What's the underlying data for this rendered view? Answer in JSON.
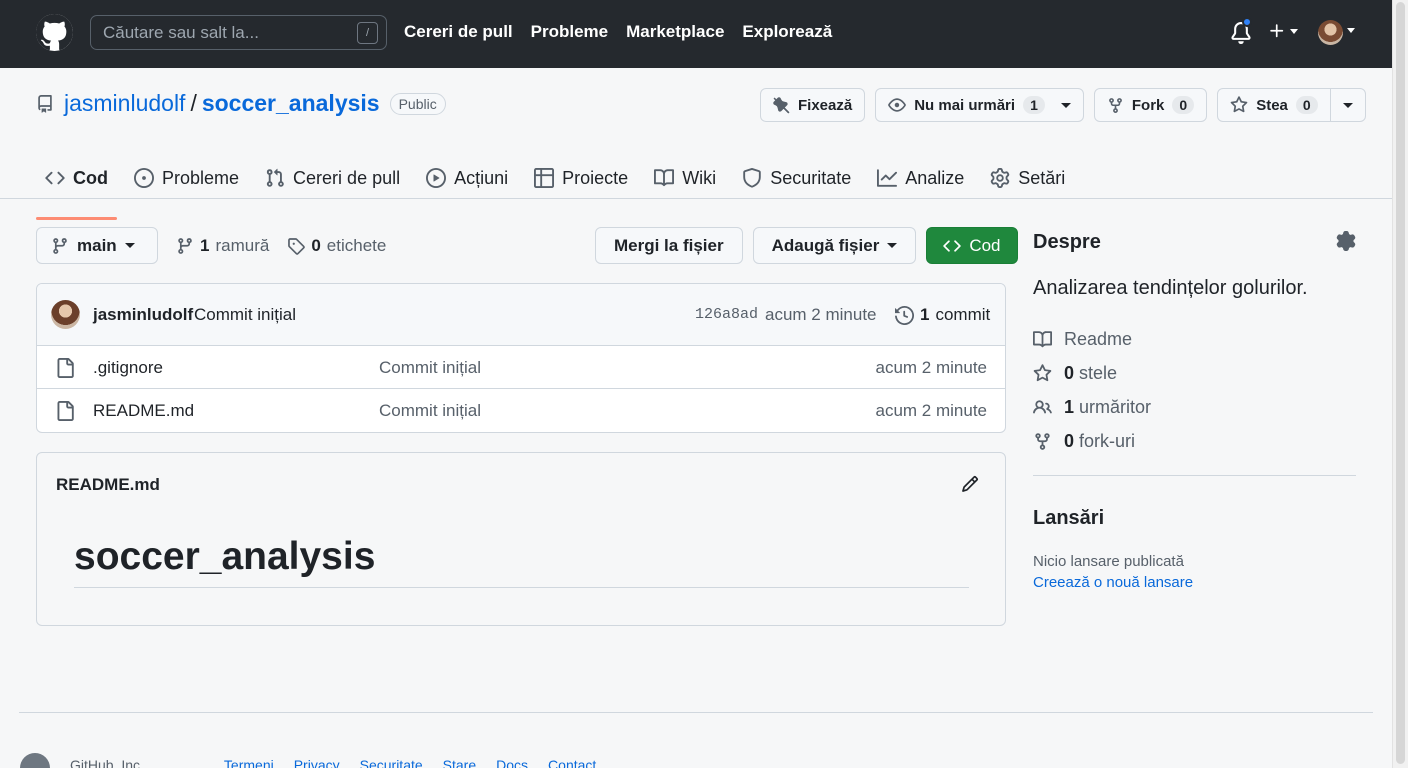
{
  "header": {
    "search_placeholder": "Căutare sau salt la...",
    "search_shortcut": "/",
    "nav": [
      "Cereri de pull",
      "Probleme",
      "Marketplace",
      "Explorează"
    ]
  },
  "repo": {
    "owner": "jasminludolf",
    "separator": "/",
    "name": "soccer_analysis",
    "visibility": "Public",
    "pin_label": "Fixează",
    "unwatch_label": "Nu mai urmări",
    "watch_count": "1",
    "fork_label": "Fork",
    "fork_count": "0",
    "star_label": "Stea",
    "star_count": "0"
  },
  "tabs": [
    {
      "label": "Cod",
      "icon": "code-icon",
      "active": true
    },
    {
      "label": "Probleme",
      "icon": "issue-icon"
    },
    {
      "label": "Cereri de pull",
      "icon": "pull-request-icon"
    },
    {
      "label": "Acțiuni",
      "icon": "play-icon"
    },
    {
      "label": "Proiecte",
      "icon": "table-icon"
    },
    {
      "label": "Wiki",
      "icon": "book-icon"
    },
    {
      "label": "Securitate",
      "icon": "shield-icon"
    },
    {
      "label": "Analize",
      "icon": "graph-icon"
    },
    {
      "label": "Setări",
      "icon": "gear-icon"
    }
  ],
  "toolbar": {
    "branch": "main",
    "branch_count": "1",
    "branch_label": "ramură",
    "tag_count": "0",
    "tag_label": "etichete",
    "go_to_file": "Mergi la fișier",
    "add_file": "Adaugă fișier",
    "code": "Cod"
  },
  "commit": {
    "user": "jasminludolf",
    "message": "Commit inițial",
    "sha": "126a8ad",
    "time": "acum 2 minute",
    "count": "1",
    "count_label": "commit"
  },
  "files": [
    {
      "name": ".gitignore",
      "message": "Commit inițial",
      "time": "acum 2 minute"
    },
    {
      "name": "README.md",
      "message": "Commit inițial",
      "time": "acum 2 minute"
    }
  ],
  "readme": {
    "filename": "README.md",
    "heading": "soccer_analysis"
  },
  "about": {
    "title": "Despre",
    "description": "Analizarea tendințelor golurilor.",
    "readme": "Readme",
    "stars_count": "0",
    "stars_label": "stele",
    "watchers_count": "1",
    "watchers_label": "urmăritor",
    "forks_count": "0",
    "forks_label": "fork-uri"
  },
  "releases": {
    "title": "Lansări",
    "none": "Nicio lansare publicată",
    "create": "Creează o nouă lansare"
  },
  "footer": {
    "copyright": "GitHub, Inc.",
    "links": [
      "Termeni",
      "Privacy",
      "Securitate",
      "Stare",
      "Docs",
      "Contact"
    ]
  },
  "colors": {
    "header_bg": "#25292e",
    "link": "#0969da",
    "green_button": "#1f883d",
    "active_tab_underline": "#fd8c73"
  }
}
